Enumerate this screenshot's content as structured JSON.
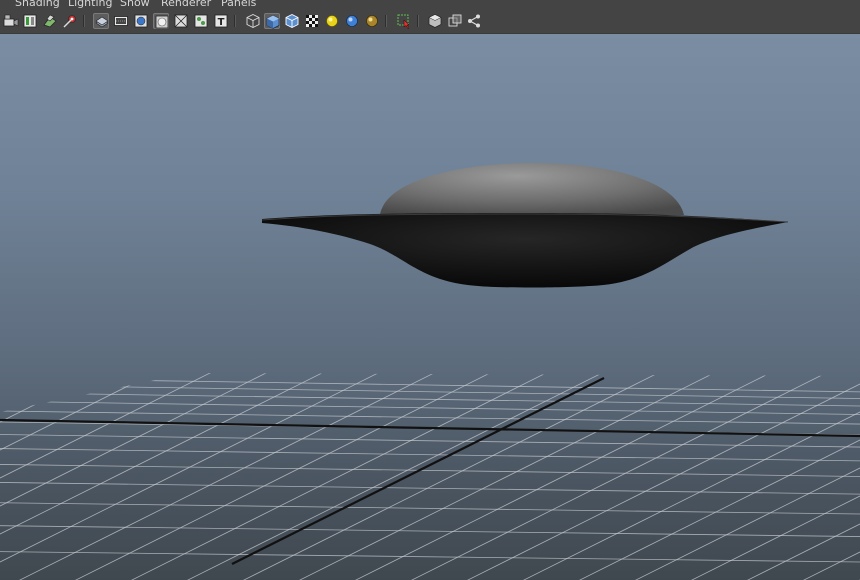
{
  "menubar": {
    "items": [
      {
        "label": "Shading"
      },
      {
        "label": "Lighting"
      },
      {
        "label": "Show"
      },
      {
        "label": "Renderer"
      },
      {
        "label": "Panels"
      }
    ]
  },
  "toolbar": {
    "icons": [
      "select-camera-icon",
      "camera-attributes-icon",
      "bookmarks-icon",
      "image-plane-icon",
      "grid-icon",
      "film-gate-icon",
      "resolution-gate-icon",
      "gate-mask-icon",
      "field-chart-icon",
      "safe-action-icon",
      "safe-title-icon",
      "wireframe-icon",
      "smooth-shade-icon",
      "wireframe-on-shaded-icon",
      "textured-icon",
      "use-default-light-icon",
      "shadows-icon",
      "ambient-occlusion-icon",
      "isolate-select-icon",
      "xray-icon",
      "xray-joints-icon",
      "xray-components-icon"
    ],
    "colors": {
      "background": "#444444",
      "active": "#5d5d5d"
    }
  },
  "viewport": {
    "colors": {
      "sky_top": "#7b8da3",
      "sky_bottom": "#40484f",
      "grid_line": "#c8ccd1",
      "grid_axis": "#111111",
      "saucer_dome": "#7a7a7a",
      "saucer_body": "#0e0e0e"
    }
  }
}
